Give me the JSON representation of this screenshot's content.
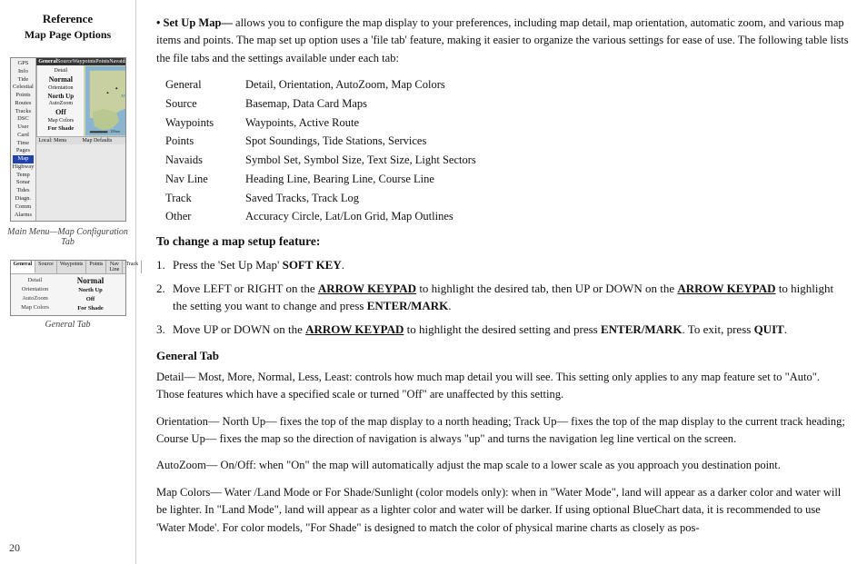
{
  "sidebar": {
    "title": "Reference",
    "subtitle": "Map Page Options",
    "page_number": "20",
    "map_caption": "Main Menu—Map Configuration Tab",
    "general_tab_caption": "General Tab",
    "map_left_items": [
      "GPS Info",
      "Tide",
      "Celestial",
      "Points",
      "Routes",
      "Tracks",
      "DSC",
      "User Card",
      "Time",
      "Pages",
      "Map",
      "Highway",
      "Temp",
      "Sonar",
      "Tides",
      "Diagn.",
      "Comm",
      "Alarms"
    ],
    "map_header": [
      "General Source Waypoints Points Navaids Nav Line"
    ],
    "detail_rows": [
      {
        "label": "Detail",
        "value": "Normal"
      },
      {
        "label": "Orientation",
        "value": "North Up"
      },
      {
        "label": "AutoZoom",
        "value": "Off"
      },
      {
        "label": "Map Colors",
        "value": "For Shade"
      }
    ],
    "tab_headers": [
      "General",
      "Source",
      "Waypoints",
      "Points",
      "Nav Line",
      "Track"
    ],
    "tab_rows": [
      {
        "label": "Detail",
        "value": "Normal"
      },
      {
        "label": "Orientation",
        "value": "North Up"
      },
      {
        "label": "AutoZoom",
        "value": "Off"
      },
      {
        "label": "Map Colors",
        "value": "For Shade"
      }
    ]
  },
  "main": {
    "intro_text": "allows you to configure the map display to your preferences, including map detail, map orientation, automatic zoom, and various map items and points. The map set up option uses a 'file tab' feature, making it easier to organize the various settings for ease of use. The following table lists the file tabs and the settings available under each tab:",
    "intro_bold": "• Set Up Map—",
    "table_rows": [
      {
        "label": "General",
        "value": "Detail, Orientation, AutoZoom, Map Colors"
      },
      {
        "label": "Source",
        "value": "Basemap, Data Card Maps"
      },
      {
        "label": "Waypoints",
        "value": "Waypoints, Active Route"
      },
      {
        "label": "Points",
        "value": "Spot Soundings, Tide Stations, Services"
      },
      {
        "label": "Navaids",
        "value": "Symbol Set, Symbol Size, Text Size, Light Sectors"
      },
      {
        "label": "Nav Line",
        "value": "Heading Line, Bearing Line, Course Line"
      },
      {
        "label": "Track",
        "value": "Saved Tracks, Track Log"
      },
      {
        "label": "Other",
        "value": "Accuracy Circle, Lat/Lon Grid, Map Outlines"
      }
    ],
    "change_heading": "To change a map setup feature:",
    "steps": [
      {
        "num": "1.",
        "text_before": "Press the 'Set Up Map' ",
        "bold": "SOFT KEY",
        "text_after": "."
      },
      {
        "num": "2.",
        "text_before": "Move LEFT or RIGHT on the ",
        "bold1": "ARROW KEYPAD",
        "text_mid": " to highlight the desired tab, then UP or DOWN on the ",
        "bold2": "ARROW KEYPAD",
        "text_after": " to highlight the setting you want to change and press ",
        "bold3": "ENTER/MARK",
        "text_end": "."
      },
      {
        "num": "3.",
        "text_before": "Move UP or DOWN on the ",
        "bold1": "ARROW KEYPAD",
        "text_mid": " to highlight the desired setting and press ",
        "bold2": "ENTER/MARK",
        "text_after": ". To exit, press ",
        "bold3": "QUIT",
        "text_end": "."
      }
    ],
    "general_tab_heading": "General Tab",
    "general_tab_paragraphs": [
      "Detail— Most, More, Normal, Less, Least: controls how much map detail you will see. This setting only applies to any map feature set to \"Auto\". Those features which have a specified scale or turned \"Off\" are unaffected by this setting.",
      "Orientation— North Up— fixes the top of the map display to a north heading; Track Up— fixes the top of the map display to the current track heading; Course Up— fixes the map so the direction of navigation is always \"up\" and turns the navigation leg line vertical on the screen.",
      "AutoZoom— On/Off: when \"On\" the map will automatically adjust the map scale to a lower scale as you approach you destination point.",
      "Map Colors— Water /Land Mode or For Shade/Sunlight (color models only): when in \"Water Mode\", land will appear as a darker color and water will be lighter. In \"Land Mode\", land will appear as a lighter color and water will be darker. If using optional BlueChart data, it is recommended to use 'Water Mode'. For color models, \"For Shade\" is designed to match the color of physical marine charts as closely as pos-"
    ]
  }
}
